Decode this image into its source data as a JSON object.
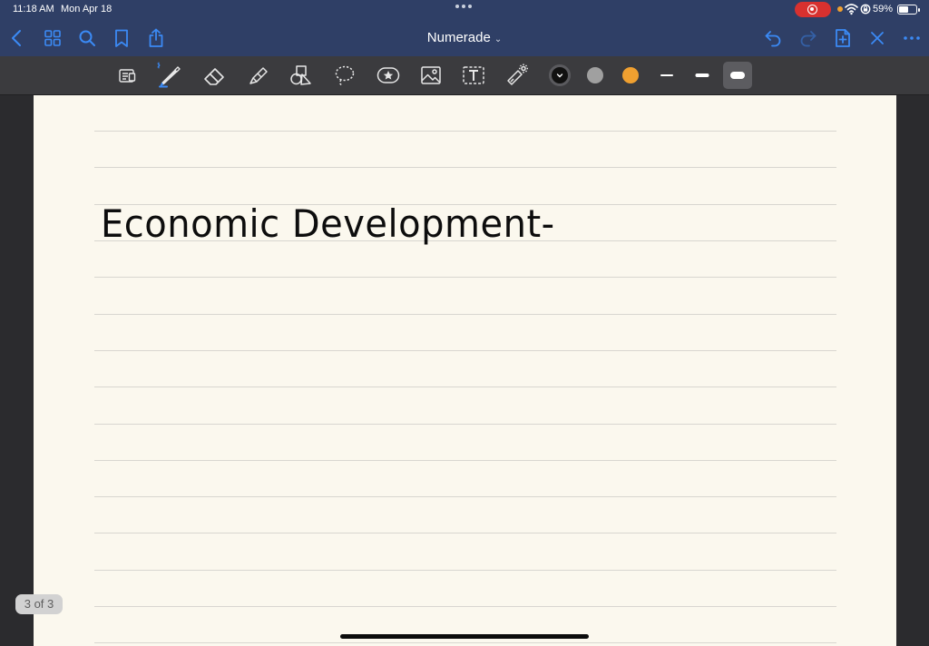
{
  "status_bar": {
    "time": "11:18 AM",
    "date": "Mon Apr 18",
    "battery_percent": "59%",
    "battery_level": 0.59,
    "recording_color": "#d8312f"
  },
  "nav_bar": {
    "title": "Numerade",
    "chevron": "⌄",
    "accent_color": "#3b8af5",
    "left_icons": [
      "back-chevron-icon",
      "grid-icon",
      "search-icon",
      "bookmark-icon",
      "share-icon"
    ],
    "right_icons": [
      "undo-icon",
      "redo-icon",
      "add-page-icon",
      "close-icon",
      "more-icon"
    ]
  },
  "toolbar": {
    "tools": [
      "read-mode-icon",
      "pen-icon",
      "eraser-icon",
      "highlighter-icon",
      "shapes-icon",
      "lasso-icon",
      "sticker-icon",
      "image-icon",
      "text-box-icon",
      "laser-pointer-icon"
    ],
    "selected_tool": "pen-icon",
    "colors": [
      "#111111",
      "#a0a0a0",
      "#f0a030"
    ],
    "selected_color": "#111111",
    "stroke_widths": [
      "thin",
      "medium",
      "thick"
    ],
    "selected_stroke": "thick"
  },
  "page": {
    "handwriting": "Economic Development-",
    "page_counter": "3 of 3"
  }
}
